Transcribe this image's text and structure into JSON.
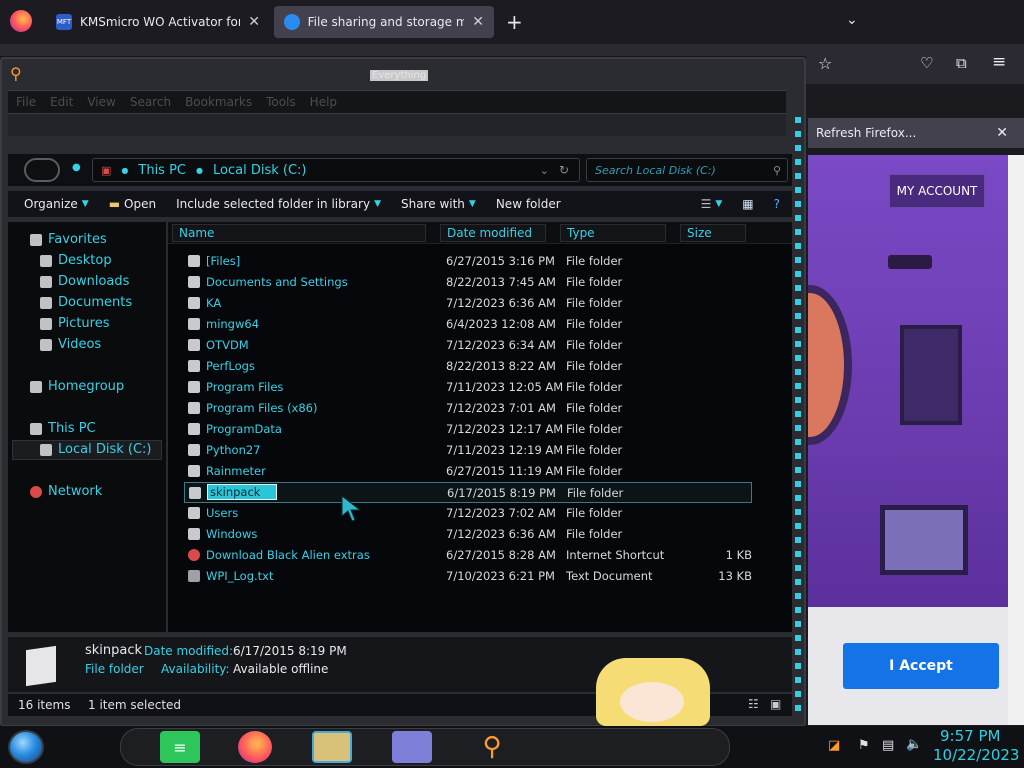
{
  "browser": {
    "tabs": [
      {
        "label": "KMSmicro WO Activator for offi",
        "favicon_text": "MFT"
      },
      {
        "label": "File sharing and storage made s"
      }
    ],
    "new_tab": "+",
    "notification": "Refresh Firefox...",
    "close": "✕"
  },
  "site": {
    "my_account": "MY ACCOUNT",
    "accept": "I Accept"
  },
  "explorer": {
    "title_watermark": "Everything",
    "menu": [
      "File",
      "Edit",
      "View",
      "Search",
      "Bookmarks",
      "Tools",
      "Help"
    ],
    "breadcrumb": [
      "This PC",
      "Local Disk (C:)"
    ],
    "search_placeholder": "Search Local Disk (C:)",
    "commands": [
      "Organize",
      "Open",
      "Include selected folder in library",
      "Share with",
      "New folder"
    ],
    "columns": [
      "Name",
      "Date modified",
      "Type",
      "Size"
    ],
    "nav": {
      "favorites": "Favorites",
      "favorites_items": [
        "Desktop",
        "Downloads",
        "Documents",
        "Pictures",
        "Videos"
      ],
      "homegroup": "Homegroup",
      "this_pc": "This PC",
      "local_disk": "Local Disk (C:)",
      "network": "Network"
    },
    "rows": [
      {
        "name": "[Files]",
        "date": "6/27/2015 3:16 PM",
        "type": "File folder",
        "size": ""
      },
      {
        "name": "Documents and Settings",
        "date": "8/22/2013 7:45 AM",
        "type": "File folder",
        "size": ""
      },
      {
        "name": "KA",
        "date": "7/12/2023 6:36 AM",
        "type": "File folder",
        "size": ""
      },
      {
        "name": "mingw64",
        "date": "6/4/2023 12:08 AM",
        "type": "File folder",
        "size": ""
      },
      {
        "name": "OTVDM",
        "date": "7/12/2023 6:34 AM",
        "type": "File folder",
        "size": ""
      },
      {
        "name": "PerfLogs",
        "date": "8/22/2013 8:22 AM",
        "type": "File folder",
        "size": ""
      },
      {
        "name": "Program Files",
        "date": "7/11/2023 12:05 AM",
        "type": "File folder",
        "size": ""
      },
      {
        "name": "Program Files (x86)",
        "date": "7/12/2023 7:01 AM",
        "type": "File folder",
        "size": ""
      },
      {
        "name": "ProgramData",
        "date": "7/12/2023 12:17 AM",
        "type": "File folder",
        "size": ""
      },
      {
        "name": "Python27",
        "date": "7/11/2023 12:19 AM",
        "type": "File folder",
        "size": ""
      },
      {
        "name": "Rainmeter",
        "date": "6/27/2015 11:19 AM",
        "type": "File folder",
        "size": ""
      },
      {
        "name": "skinpack",
        "date": "6/17/2015 8:19 PM",
        "type": "File folder",
        "size": "",
        "selected": true
      },
      {
        "name": "Users",
        "date": "7/12/2023 7:02 AM",
        "type": "File folder",
        "size": ""
      },
      {
        "name": "Windows",
        "date": "7/12/2023 6:36 AM",
        "type": "File folder",
        "size": ""
      },
      {
        "name": "Download Black Alien extras",
        "date": "6/27/2015 8:28 AM",
        "type": "Internet Shortcut",
        "size": "1 KB"
      },
      {
        "name": "WPI_Log.txt",
        "date": "7/10/2023 6:21 PM",
        "type": "Text Document",
        "size": "13 KB"
      }
    ],
    "details": {
      "name": "skinpack",
      "kind": "File folder",
      "date_label": "Date modified:",
      "date_value": "6/17/2015 8:19 PM",
      "avail_label": "Availability:",
      "avail_value": "Available offline"
    },
    "status": {
      "items": "16 items",
      "selected": "1 item selected"
    }
  },
  "taskbar": {
    "time": "9:57 PM",
    "date": "10/22/2023"
  }
}
